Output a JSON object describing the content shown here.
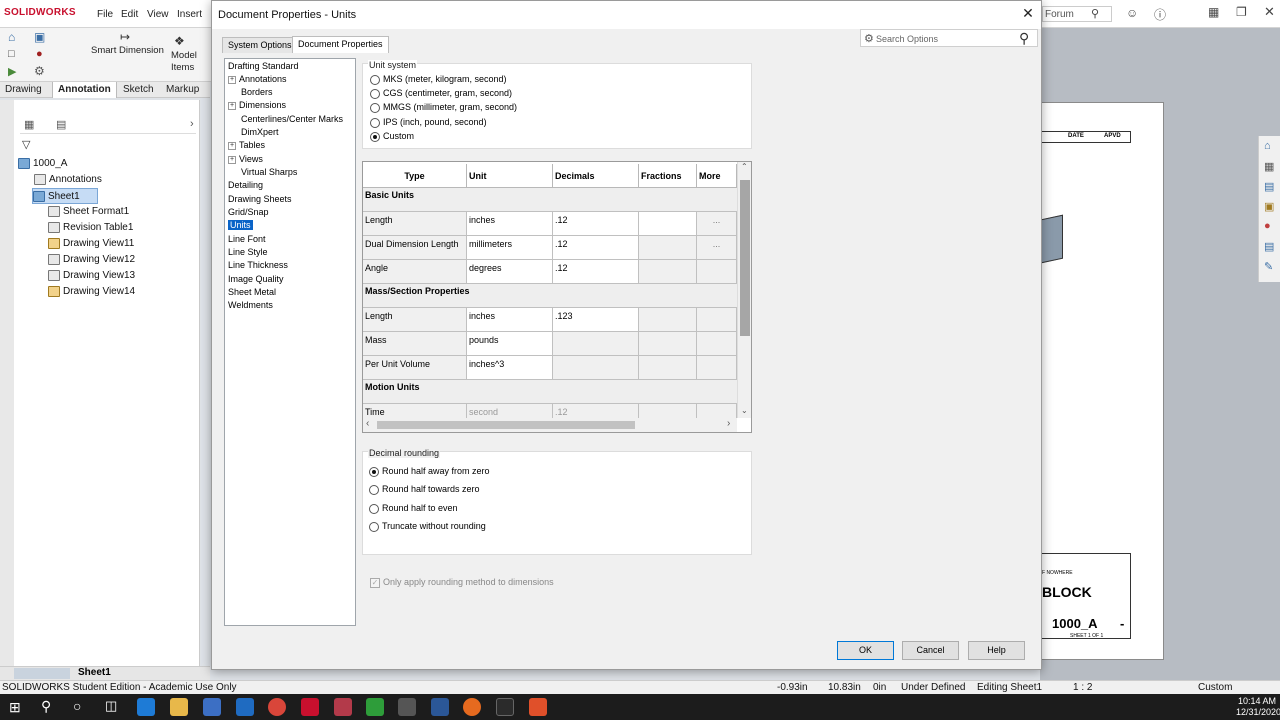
{
  "app": {
    "logo": "SOLIDWORKS",
    "menus": [
      "File",
      "Edit",
      "View",
      "Insert"
    ],
    "search_placeholder": "Forum"
  },
  "ribbon": {
    "smart_dimension": "Smart Dimension",
    "model_items_1": "Model",
    "model_items_2": "Items",
    "tabs": [
      "Drawing",
      "Annotation",
      "Sketch",
      "Markup"
    ],
    "active_tab": "Annotation"
  },
  "tree": {
    "root": "1000_A",
    "items": [
      {
        "label": "Annotations",
        "indent": 1
      },
      {
        "label": "Sheet1",
        "indent": 1
      },
      {
        "label": "Sheet Format1",
        "indent": 2
      },
      {
        "label": "Revision Table1",
        "indent": 2
      },
      {
        "label": "Drawing View11",
        "indent": 2
      },
      {
        "label": "Drawing View12",
        "indent": 2
      },
      {
        "label": "Drawing View13",
        "indent": 2
      },
      {
        "label": "Drawing View14",
        "indent": 2
      }
    ],
    "sheet_tab": "Sheet1"
  },
  "dialog": {
    "title": "Document Properties - Units",
    "tabs": [
      "System Options",
      "Document Properties"
    ],
    "search_placeholder": "Search Options",
    "categories": [
      {
        "label": "Drafting Standard",
        "child": false,
        "expand": false
      },
      {
        "label": "Annotations",
        "child": false,
        "expand": true
      },
      {
        "label": "Borders",
        "child": true,
        "expand": false
      },
      {
        "label": "Dimensions",
        "child": false,
        "expand": true
      },
      {
        "label": "Centerlines/Center Marks",
        "child": true,
        "expand": false
      },
      {
        "label": "DimXpert",
        "child": true,
        "expand": false
      },
      {
        "label": "Tables",
        "child": false,
        "expand": true
      },
      {
        "label": "Views",
        "child": false,
        "expand": true
      },
      {
        "label": "Virtual Sharps",
        "child": true,
        "expand": false
      },
      {
        "label": "Detailing",
        "child": false,
        "expand": false
      },
      {
        "label": "Drawing Sheets",
        "child": false,
        "expand": false
      },
      {
        "label": "Grid/Snap",
        "child": false,
        "expand": false
      },
      {
        "label": "Units",
        "child": false,
        "expand": false,
        "selected": true
      },
      {
        "label": "Line Font",
        "child": false,
        "expand": false
      },
      {
        "label": "Line Style",
        "child": false,
        "expand": false
      },
      {
        "label": "Line Thickness",
        "child": false,
        "expand": false
      },
      {
        "label": "Image Quality",
        "child": false,
        "expand": false
      },
      {
        "label": "Sheet Metal",
        "child": false,
        "expand": false
      },
      {
        "label": "Weldments",
        "child": false,
        "expand": false
      }
    ],
    "unit_system_label": "Unit system",
    "unit_systems": [
      {
        "label": "MKS  (meter, kilogram, second)",
        "checked": false
      },
      {
        "label": "CGS  (centimeter, gram, second)",
        "checked": false
      },
      {
        "label": "MMGS  (millimeter, gram, second)",
        "checked": false
      },
      {
        "label": "IPS  (inch, pound, second)",
        "checked": false
      },
      {
        "label": "Custom",
        "checked": true
      }
    ],
    "table": {
      "headers": [
        "Type",
        "Unit",
        "Decimals",
        "Fractions",
        "More"
      ],
      "rows": [
        {
          "section": "Basic Units"
        },
        {
          "type": "Length",
          "unit": "inches",
          "decimals": ".12",
          "fractions": "",
          "more": "...",
          "grey": false
        },
        {
          "type": "Dual Dimension Length",
          "unit": "millimeters",
          "decimals": ".12",
          "fractions": "",
          "more": "...",
          "grey": false
        },
        {
          "type": "Angle",
          "unit": "degrees",
          "decimals": ".12",
          "fractions": "",
          "more": "",
          "grey": false
        },
        {
          "section": "Mass/Section Properties"
        },
        {
          "type": "Length",
          "unit": "inches",
          "decimals": ".123",
          "fractions": "",
          "more": "",
          "grey": false
        },
        {
          "type": "Mass",
          "unit": "pounds",
          "decimals": "",
          "fractions": "",
          "more": "",
          "grey": false
        },
        {
          "type": "Per Unit Volume",
          "unit": "inches^3",
          "decimals": "",
          "fractions": "",
          "more": "",
          "grey": false
        },
        {
          "section": "Motion Units"
        },
        {
          "type": "Time",
          "unit": "second",
          "decimals": ".12",
          "fractions": "",
          "more": "",
          "grey": true
        }
      ]
    },
    "rounding_label": "Decimal rounding",
    "rounding": [
      {
        "label": "Round half away from zero",
        "checked": true
      },
      {
        "label": "Round half towards zero",
        "checked": false
      },
      {
        "label": "Round half to even",
        "checked": false
      },
      {
        "label": "Truncate without rounding",
        "checked": false
      }
    ],
    "only_apply": "Only apply rounding method to dimensions",
    "buttons": {
      "ok": "OK",
      "cancel": "Cancel",
      "help": "Help"
    }
  },
  "sheet": {
    "date": "DATE",
    "apvd": "APVD",
    "nowhere": "F NOWHERE",
    "block": "BLOCK",
    "dwg_no": "1000_A",
    "rev": "-",
    "sheet_of": "SHEET 1 OF 1"
  },
  "status": {
    "edition": "SOLIDWORKS Student Edition - Academic Use Only",
    "x": "-0.93in",
    "y": "10.83in",
    "z": "0in",
    "defined": "Under Defined",
    "editing": "Editing Sheet1",
    "scale": "1 : 2",
    "units": "Custom"
  },
  "taskbar": {
    "time": "10:14 AM",
    "date": "12/31/2020"
  }
}
